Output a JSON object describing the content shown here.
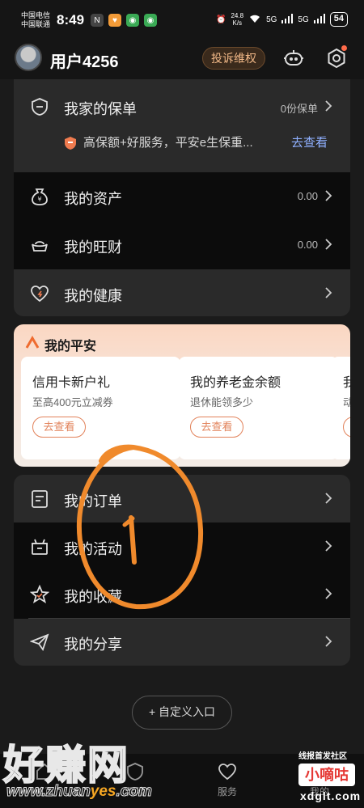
{
  "status_bar": {
    "carrier1": "中国电信",
    "carrier2": "中国联通",
    "time": "8:49",
    "net_speed_value": "24.8",
    "net_speed_unit": "K/s",
    "signal1": "5G",
    "signal2": "5G",
    "battery": "54"
  },
  "header": {
    "username": "用户4256",
    "complain_label": "投诉维权"
  },
  "card1": {
    "policy_label": "我家的保单",
    "policy_value": "0份保单",
    "promo_text": "高保额+好服务，平安e生保重...",
    "promo_link": "去查看",
    "assets_label": "我的资产",
    "assets_value": "0.00",
    "wangcai_label": "我的旺财",
    "wangcai_value": "0.00",
    "health_label": "我的健康"
  },
  "my_pingan": {
    "title": "我的平安",
    "cards": [
      {
        "title": "信用卡新户礼",
        "subtitle": "至高400元立减券",
        "button": "去查看"
      },
      {
        "title": "我的养老金余额",
        "subtitle": "退休能领多少",
        "button": "去查看"
      },
      {
        "title": "我",
        "subtitle": "动",
        "button": ""
      }
    ]
  },
  "card2": {
    "orders_label": "我的订单",
    "activities_label": "我的活动",
    "favorites_label": "我的收藏",
    "share_label": "我的分享"
  },
  "custom_entry": "+ 自定义入口",
  "tabbar": {
    "tabs": [
      {
        "label": "首页"
      },
      {
        "label": "保险"
      },
      {
        "label": "服务"
      },
      {
        "label": "我的"
      }
    ]
  },
  "watermark": {
    "big": "好赚网",
    "url_prefix": "www.zhuan",
    "url_highlight": "yes",
    "url_suffix": ".com",
    "right_top": "线报首发社区",
    "right_box": "小嘀咕",
    "right_url": "xdglt.com"
  },
  "colors": {
    "accent_orange": "#e2825a",
    "link_blue": "#8fb0ff",
    "complain_text": "#f2b988"
  }
}
